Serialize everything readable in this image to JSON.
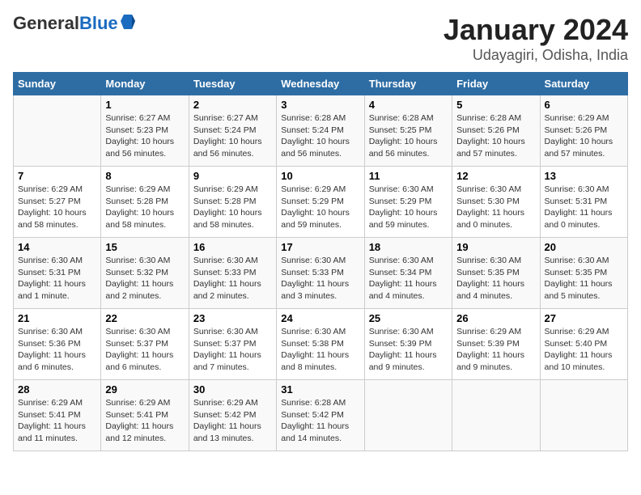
{
  "header": {
    "logo_general": "General",
    "logo_blue": "Blue",
    "month": "January 2024",
    "location": "Udayagiri, Odisha, India"
  },
  "weekdays": [
    "Sunday",
    "Monday",
    "Tuesday",
    "Wednesday",
    "Thursday",
    "Friday",
    "Saturday"
  ],
  "weeks": [
    [
      {
        "day": "",
        "info": ""
      },
      {
        "day": "1",
        "info": "Sunrise: 6:27 AM\nSunset: 5:23 PM\nDaylight: 10 hours\nand 56 minutes."
      },
      {
        "day": "2",
        "info": "Sunrise: 6:27 AM\nSunset: 5:24 PM\nDaylight: 10 hours\nand 56 minutes."
      },
      {
        "day": "3",
        "info": "Sunrise: 6:28 AM\nSunset: 5:24 PM\nDaylight: 10 hours\nand 56 minutes."
      },
      {
        "day": "4",
        "info": "Sunrise: 6:28 AM\nSunset: 5:25 PM\nDaylight: 10 hours\nand 56 minutes."
      },
      {
        "day": "5",
        "info": "Sunrise: 6:28 AM\nSunset: 5:26 PM\nDaylight: 10 hours\nand 57 minutes."
      },
      {
        "day": "6",
        "info": "Sunrise: 6:29 AM\nSunset: 5:26 PM\nDaylight: 10 hours\nand 57 minutes."
      }
    ],
    [
      {
        "day": "7",
        "info": "Sunrise: 6:29 AM\nSunset: 5:27 PM\nDaylight: 10 hours\nand 58 minutes."
      },
      {
        "day": "8",
        "info": "Sunrise: 6:29 AM\nSunset: 5:28 PM\nDaylight: 10 hours\nand 58 minutes."
      },
      {
        "day": "9",
        "info": "Sunrise: 6:29 AM\nSunset: 5:28 PM\nDaylight: 10 hours\nand 58 minutes."
      },
      {
        "day": "10",
        "info": "Sunrise: 6:29 AM\nSunset: 5:29 PM\nDaylight: 10 hours\nand 59 minutes."
      },
      {
        "day": "11",
        "info": "Sunrise: 6:30 AM\nSunset: 5:29 PM\nDaylight: 10 hours\nand 59 minutes."
      },
      {
        "day": "12",
        "info": "Sunrise: 6:30 AM\nSunset: 5:30 PM\nDaylight: 11 hours\nand 0 minutes."
      },
      {
        "day": "13",
        "info": "Sunrise: 6:30 AM\nSunset: 5:31 PM\nDaylight: 11 hours\nand 0 minutes."
      }
    ],
    [
      {
        "day": "14",
        "info": "Sunrise: 6:30 AM\nSunset: 5:31 PM\nDaylight: 11 hours\nand 1 minute."
      },
      {
        "day": "15",
        "info": "Sunrise: 6:30 AM\nSunset: 5:32 PM\nDaylight: 11 hours\nand 2 minutes."
      },
      {
        "day": "16",
        "info": "Sunrise: 6:30 AM\nSunset: 5:33 PM\nDaylight: 11 hours\nand 2 minutes."
      },
      {
        "day": "17",
        "info": "Sunrise: 6:30 AM\nSunset: 5:33 PM\nDaylight: 11 hours\nand 3 minutes."
      },
      {
        "day": "18",
        "info": "Sunrise: 6:30 AM\nSunset: 5:34 PM\nDaylight: 11 hours\nand 4 minutes."
      },
      {
        "day": "19",
        "info": "Sunrise: 6:30 AM\nSunset: 5:35 PM\nDaylight: 11 hours\nand 4 minutes."
      },
      {
        "day": "20",
        "info": "Sunrise: 6:30 AM\nSunset: 5:35 PM\nDaylight: 11 hours\nand 5 minutes."
      }
    ],
    [
      {
        "day": "21",
        "info": "Sunrise: 6:30 AM\nSunset: 5:36 PM\nDaylight: 11 hours\nand 6 minutes."
      },
      {
        "day": "22",
        "info": "Sunrise: 6:30 AM\nSunset: 5:37 PM\nDaylight: 11 hours\nand 6 minutes."
      },
      {
        "day": "23",
        "info": "Sunrise: 6:30 AM\nSunset: 5:37 PM\nDaylight: 11 hours\nand 7 minutes."
      },
      {
        "day": "24",
        "info": "Sunrise: 6:30 AM\nSunset: 5:38 PM\nDaylight: 11 hours\nand 8 minutes."
      },
      {
        "day": "25",
        "info": "Sunrise: 6:30 AM\nSunset: 5:39 PM\nDaylight: 11 hours\nand 9 minutes."
      },
      {
        "day": "26",
        "info": "Sunrise: 6:29 AM\nSunset: 5:39 PM\nDaylight: 11 hours\nand 9 minutes."
      },
      {
        "day": "27",
        "info": "Sunrise: 6:29 AM\nSunset: 5:40 PM\nDaylight: 11 hours\nand 10 minutes."
      }
    ],
    [
      {
        "day": "28",
        "info": "Sunrise: 6:29 AM\nSunset: 5:41 PM\nDaylight: 11 hours\nand 11 minutes."
      },
      {
        "day": "29",
        "info": "Sunrise: 6:29 AM\nSunset: 5:41 PM\nDaylight: 11 hours\nand 12 minutes."
      },
      {
        "day": "30",
        "info": "Sunrise: 6:29 AM\nSunset: 5:42 PM\nDaylight: 11 hours\nand 13 minutes."
      },
      {
        "day": "31",
        "info": "Sunrise: 6:28 AM\nSunset: 5:42 PM\nDaylight: 11 hours\nand 14 minutes."
      },
      {
        "day": "",
        "info": ""
      },
      {
        "day": "",
        "info": ""
      },
      {
        "day": "",
        "info": ""
      }
    ]
  ]
}
